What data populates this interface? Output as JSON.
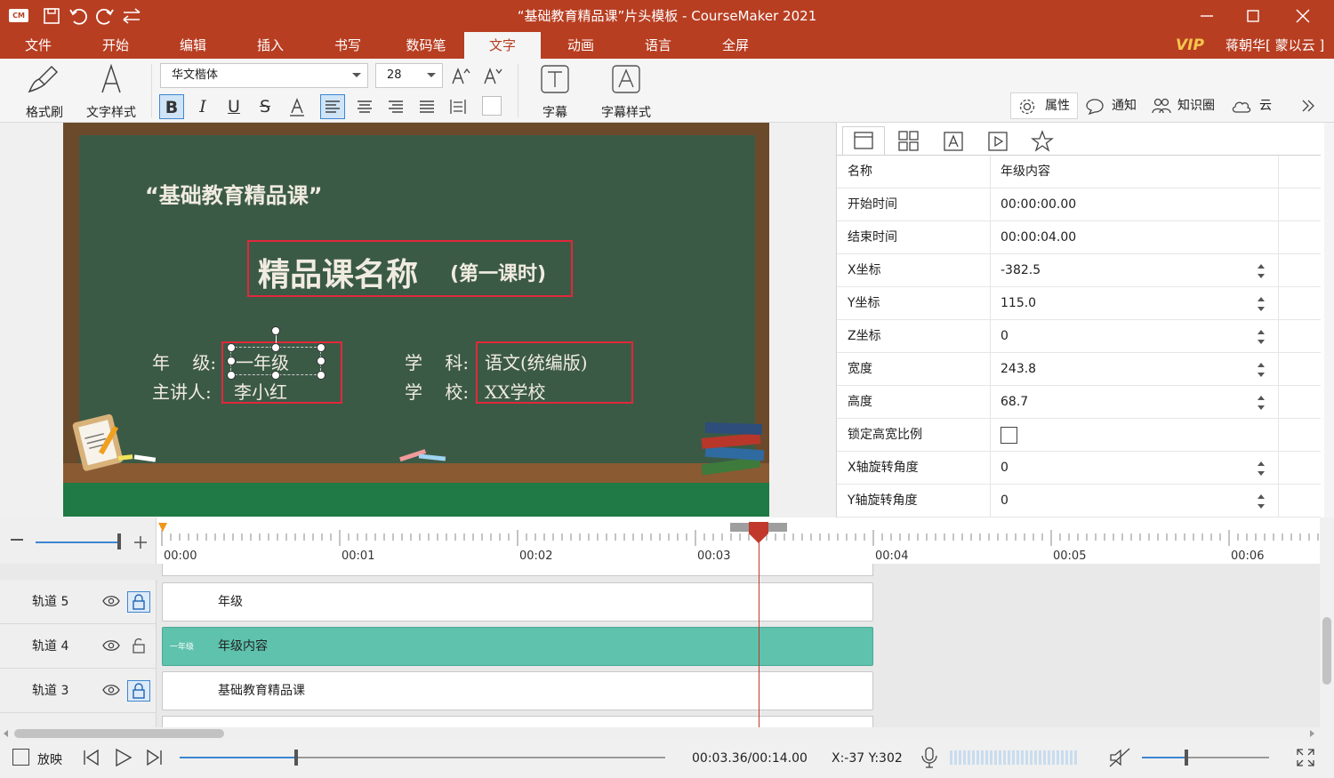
{
  "app": {
    "logo_text": "CM",
    "window_title": "“基础教育精品课”片头模板 - CourseMaker 2021",
    "accent": "#b83e22"
  },
  "menu": {
    "items": [
      "文件",
      "开始",
      "编辑",
      "插入",
      "书写",
      "数码笔",
      "文字",
      "动画",
      "语言",
      "全屏"
    ],
    "active": "文字",
    "vip": "VIP",
    "user": "蒋朝华[ 蒙以云 ]"
  },
  "ribbon": {
    "format_painter": "格式刷",
    "text_style": "文字样式",
    "font_name": "华文楷体",
    "font_size": "28",
    "subtitle": "字幕",
    "subtitle_style": "字幕样式",
    "side_tabs": [
      "属性",
      "通知",
      "知识圈",
      "云"
    ]
  },
  "slide": {
    "header": "“基础教育精品课”",
    "title_main": "精品课名称",
    "title_sub": "(第一课时)",
    "grade_label": "年    级:",
    "grade_value": "一年级",
    "teacher_label": "主讲人:",
    "teacher_value": "李小红",
    "subject_label": "学    科:",
    "subject_value": "语文(统编版)",
    "school_label": "学    校:",
    "school_value": "XX学校",
    "board_color": "#3b5a46"
  },
  "properties": {
    "rows": [
      {
        "label": "名称",
        "value": "年级内容"
      },
      {
        "label": "开始时间",
        "value": "00:00:00.00"
      },
      {
        "label": "结束时间",
        "value": "00:00:04.00"
      },
      {
        "label": "X坐标",
        "value": "-382.5"
      },
      {
        "label": "Y坐标",
        "value": "115.0"
      },
      {
        "label": "Z坐标",
        "value": "0"
      },
      {
        "label": "宽度",
        "value": "243.8"
      },
      {
        "label": "高度",
        "value": "68.7"
      },
      {
        "label": "锁定高宽比例",
        "value": ""
      },
      {
        "label": "X轴旋转角度",
        "value": "0"
      },
      {
        "label": "Y轴旋转角度",
        "value": "0"
      }
    ]
  },
  "timeline": {
    "ticks": [
      "00:00",
      "00:01",
      "00:02",
      "00:03",
      "00:04",
      "00:05",
      "00:06"
    ],
    "playhead_seconds": 3.36,
    "tracks": [
      {
        "name": "轨道 5",
        "clip": "年级",
        "locked": true,
        "selected": false
      },
      {
        "name": "轨道 4",
        "clip": "年级内容",
        "locked": false,
        "selected": true,
        "thumb": "一年级"
      },
      {
        "name": "轨道 3",
        "clip": "基础教育精品课",
        "locked": true,
        "selected": false
      }
    ],
    "clip_color": "#5ec2ad"
  },
  "bottom": {
    "play_label": "放映",
    "time": "00:03.36/00:14.00",
    "coords": "X:-37 Y:302"
  }
}
